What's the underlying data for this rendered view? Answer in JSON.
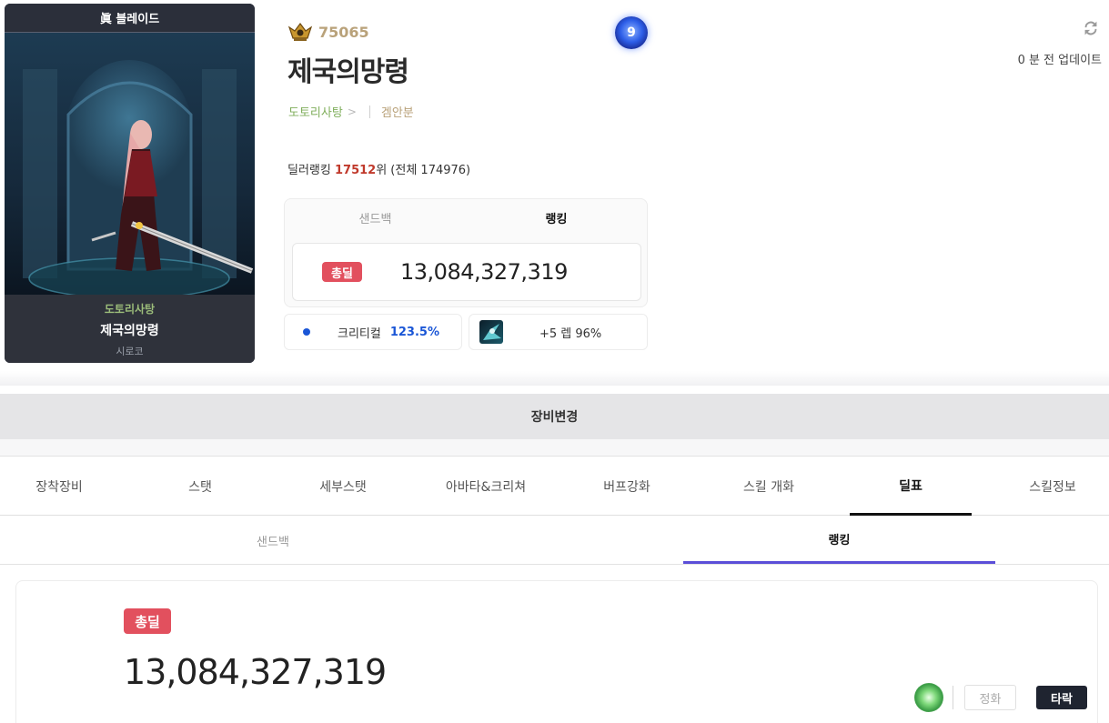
{
  "card": {
    "job_title": "眞 블레이드",
    "server": "도토리사탕",
    "name": "제국의망령",
    "sub": "시로코"
  },
  "profile": {
    "fame_value": "75065",
    "name": "제국의망령",
    "level_badge": "9",
    "server": "도토리사탕",
    "chevron": ">",
    "adventure": "겜안분",
    "update_text": "0 분 전 업데이트",
    "dealer_rank_prefix": "딜러랭킹 ",
    "dealer_rank_value": "17512",
    "dealer_rank_suffix": "위 (전체 174976)"
  },
  "upper_panel": {
    "tab_sandbag": "샌드백",
    "tab_ranking": "랭킹",
    "badge": "총딜",
    "total_damage": "13,084,327,319"
  },
  "stats": {
    "crit_label": "크리티컬",
    "crit_value": "123.5%",
    "skill_text": "+5 렙 96%"
  },
  "equip_change": "장비변경",
  "main_tabs": [
    "장착장비",
    "스탯",
    "세부스탯",
    "아바타&크리쳐",
    "버프강화",
    "스킬 개화",
    "딜표",
    "스킬정보"
  ],
  "main_tab_active": "딜표",
  "sub_tabs": [
    "샌드백",
    "랭킹"
  ],
  "sub_tab_active": "랭킹",
  "lower_panel": {
    "badge": "총딜",
    "total_damage": "13,084,327,319",
    "btn_jeong": "정화",
    "btn_tarak": "타락"
  },
  "colors": {
    "badge_red": "#e2505e",
    "rank_red": "#c0392b",
    "crit_blue": "#1a56d6",
    "server_green": "#7fae5b",
    "sub_tab_accent": "#5b4ed8"
  }
}
